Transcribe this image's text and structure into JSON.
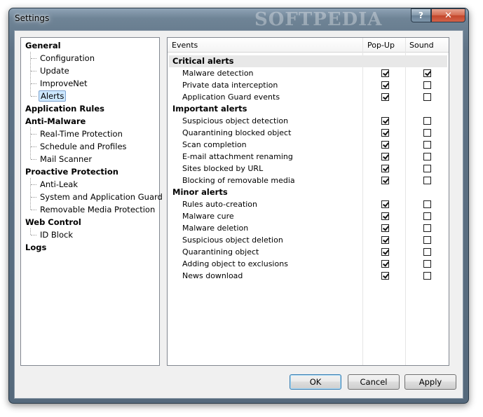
{
  "window": {
    "title": "Settings",
    "watermark": "SOFTPEDIA",
    "help_glyph": "?",
    "close_glyph": "✕"
  },
  "tree": [
    {
      "label": "General",
      "children": [
        {
          "label": "Configuration"
        },
        {
          "label": "Update"
        },
        {
          "label": "ImproveNet"
        },
        {
          "label": "Alerts",
          "selected": true
        }
      ]
    },
    {
      "label": "Application Rules",
      "children": []
    },
    {
      "label": "Anti-Malware",
      "children": [
        {
          "label": "Real-Time Protection"
        },
        {
          "label": "Schedule and Profiles"
        },
        {
          "label": "Mail Scanner"
        }
      ]
    },
    {
      "label": "Proactive Protection",
      "children": [
        {
          "label": "Anti-Leak"
        },
        {
          "label": "System and Application Guard"
        },
        {
          "label": "Removable Media Protection"
        }
      ]
    },
    {
      "label": "Web Control",
      "children": [
        {
          "label": "ID Block"
        }
      ]
    },
    {
      "label": "Logs",
      "children": []
    }
  ],
  "list": {
    "columns": {
      "events": "Events",
      "popup": "Pop-Up",
      "sound": "Sound"
    },
    "groups": [
      {
        "label": "Critical alerts",
        "rows": [
          {
            "label": "Malware detection",
            "popup": true,
            "sound": true
          },
          {
            "label": "Private data interception",
            "popup": true,
            "sound": false
          },
          {
            "label": "Application Guard events",
            "popup": true,
            "sound": false
          }
        ]
      },
      {
        "label": "Important alerts",
        "rows": [
          {
            "label": "Suspicious object detection",
            "popup": true,
            "sound": false
          },
          {
            "label": "Quarantining blocked object",
            "popup": true,
            "sound": false
          },
          {
            "label": "Scan completion",
            "popup": true,
            "sound": false
          },
          {
            "label": "E-mail attachment renaming",
            "popup": true,
            "sound": false
          },
          {
            "label": "Sites blocked by URL",
            "popup": true,
            "sound": false
          },
          {
            "label": "Blocking of removable media",
            "popup": true,
            "sound": false
          }
        ]
      },
      {
        "label": "Minor alerts",
        "rows": [
          {
            "label": "Rules auto-creation",
            "popup": true,
            "sound": false
          },
          {
            "label": "Malware cure",
            "popup": true,
            "sound": false
          },
          {
            "label": "Malware deletion",
            "popup": true,
            "sound": false
          },
          {
            "label": "Suspicious object deletion",
            "popup": true,
            "sound": false
          },
          {
            "label": "Quarantining object",
            "popup": true,
            "sound": false
          },
          {
            "label": "Adding object to exclusions",
            "popup": true,
            "sound": false
          },
          {
            "label": "News download",
            "popup": true,
            "sound": false
          }
        ]
      }
    ]
  },
  "buttons": {
    "ok": "OK",
    "cancel": "Cancel",
    "apply": "Apply"
  }
}
